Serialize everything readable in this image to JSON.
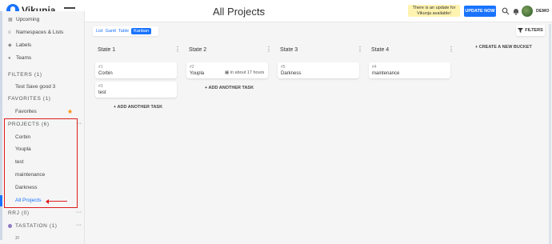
{
  "app": {
    "name": "Vikunja"
  },
  "header": {
    "title": "All Projects",
    "menu_glyph": "···",
    "update_notice": "There is an update for Vikunja available!",
    "update_button": "UPDATE NOW",
    "username": "DEMO"
  },
  "sidebar": {
    "nav": [
      {
        "label": "Upcoming",
        "icon": "calendar-icon"
      },
      {
        "label": "Namespaces & Lists",
        "icon": "layers-icon"
      },
      {
        "label": "Labels",
        "icon": "tags-icon"
      },
      {
        "label": "Teams",
        "icon": "users-icon"
      }
    ],
    "filters": {
      "heading": "FILTERS (1)",
      "items": [
        "Test Save good 3"
      ]
    },
    "favorites": {
      "heading": "FAVORITES (1)",
      "items": [
        "Favorites"
      ]
    },
    "projects": {
      "heading": "PROJECTS (6)",
      "items": [
        "Corbin",
        "Youpla",
        "test",
        "maintenance",
        "Darkness",
        "All Projects"
      ]
    },
    "rrj": {
      "heading": "RRJ (0)"
    },
    "tastation": {
      "heading": "TASTATION (1)"
    },
    "partial": "zr"
  },
  "views": {
    "tabs": [
      "List",
      "Gantt",
      "Table",
      "Kanban"
    ],
    "active": "Kanban"
  },
  "filters_button": "FILTERS",
  "add_task_label": "+ ADD ANOTHER TASK",
  "new_bucket_label": "+ CREATE A NEW BUCKET",
  "buckets": [
    {
      "title": "State 1",
      "cards": [
        {
          "num": "#1",
          "title": "Corbin"
        },
        {
          "num": "#3",
          "title": "test"
        }
      ]
    },
    {
      "title": "State 2",
      "cards": [
        {
          "num": "#2",
          "title": "Youpla",
          "due": "in about 17 hours"
        }
      ]
    },
    {
      "title": "State 3",
      "cards": [
        {
          "num": "#5",
          "title": "Darkness"
        }
      ]
    },
    {
      "title": "State 4",
      "cards": [
        {
          "num": "#4",
          "title": "maintenance"
        }
      ]
    }
  ],
  "colors": {
    "accent": "#1973ff",
    "highlight": "#e01b1b",
    "favorite": "#ff8a00",
    "update_bg": "#fff3b0"
  }
}
